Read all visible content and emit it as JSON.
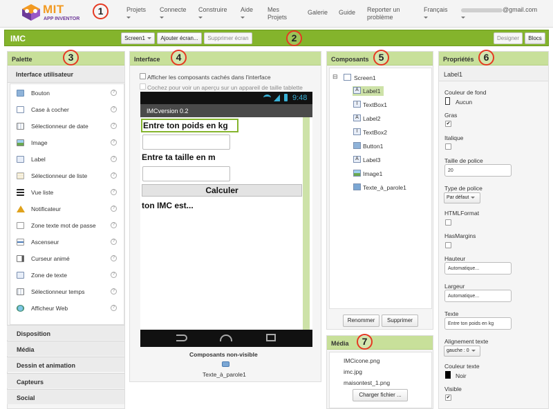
{
  "topbar": {
    "logo_title": "MIT",
    "logo_subtitle": "APP INVENTOR",
    "menu": [
      "Projets",
      "Connecte",
      "Construire",
      "Aide"
    ],
    "links": [
      "Mes Projets",
      "Galerie",
      "Guide",
      "Reporter un problème"
    ],
    "language": "Français",
    "account": "@gmail.com"
  },
  "badges": [
    "1",
    "2",
    "3",
    "4",
    "5",
    "6",
    "7"
  ],
  "toolbar": {
    "project_name": "IMC",
    "screen_select": "Screen1",
    "add_screen": "Ajouter écran...",
    "remove_screen": "Supprimer écran",
    "designer": "Designer",
    "blocks": "Blocs"
  },
  "palette": {
    "title": "Palette",
    "section": "Interface utilisateur",
    "items": [
      {
        "label": "Bouton",
        "icon": "button-icon"
      },
      {
        "label": "Case à cocher",
        "icon": "checkbox-icon"
      },
      {
        "label": "Sélectionneur de date",
        "icon": "date-picker-icon"
      },
      {
        "label": "Image",
        "icon": "image-icon"
      },
      {
        "label": "Label",
        "icon": "label-icon"
      },
      {
        "label": "Sélectionneur de liste",
        "icon": "list-picker-icon"
      },
      {
        "label": "Vue liste",
        "icon": "list-view-icon"
      },
      {
        "label": "Notificateur",
        "icon": "notifier-icon"
      },
      {
        "label": "Zone texte mot de passe",
        "icon": "password-icon"
      },
      {
        "label": "Ascenseur",
        "icon": "slider-icon"
      },
      {
        "label": "Curseur animé",
        "icon": "spinner-icon"
      },
      {
        "label": "Zone de texte",
        "icon": "textbox-icon"
      },
      {
        "label": "Sélectionneur temps",
        "icon": "time-picker-icon"
      },
      {
        "label": "Afficheur Web",
        "icon": "web-viewer-icon"
      }
    ],
    "help_glyph": "?",
    "categories": [
      "Disposition",
      "Média",
      "Dessin et animation",
      "Capteurs",
      "Social"
    ]
  },
  "viewer": {
    "title": "Interface",
    "show_hidden": "Afficher les composants cachés dans l'interface",
    "tablet_preview": "Cochez pour voir un aperçu sur un appareil de taille tablette",
    "clock": "9:48",
    "app_title": "IMCversion 0.2",
    "label1": "Entre ton poids en kg",
    "label2": "Entre ta taille en m",
    "button1": "Calculer",
    "label3": "ton IMC est...",
    "nonvisible_title": "Composants non-visible",
    "nonvisible_item": "Texte_à_parole1"
  },
  "components": {
    "title": "Composants",
    "tree_toggle": "⊟",
    "items": [
      {
        "name": "Screen1",
        "glyph": ""
      },
      {
        "name": "Label1",
        "glyph": "A"
      },
      {
        "name": "TextBox1",
        "glyph": "I"
      },
      {
        "name": "Label2",
        "glyph": "A"
      },
      {
        "name": "TextBox2",
        "glyph": "I"
      },
      {
        "name": "Button1",
        "glyph": ""
      },
      {
        "name": "Label3",
        "glyph": "A"
      },
      {
        "name": "Image1",
        "glyph": ""
      },
      {
        "name": "Texte_à_parole1",
        "glyph": ""
      }
    ],
    "rename": "Renommer",
    "delete": "Supprimer"
  },
  "media": {
    "title": "Média",
    "files": [
      "IMCicone.png",
      "imc.jpg",
      "maisontest_1.png"
    ],
    "upload": "Charger fichier ..."
  },
  "properties": {
    "title": "Propriétés",
    "component": "Label1",
    "bg_color_label": "Couleur de fond",
    "bg_color_value": "Aucun",
    "bold_label": "Gras",
    "italic_label": "Italique",
    "font_size_label": "Taille de police",
    "font_size_value": "20",
    "font_type_label": "Type de police",
    "font_type_value": "Par défaut",
    "html_label": "HTMLFormat",
    "margins_label": "HasMargins",
    "height_label": "Hauteur",
    "height_value": "Automatique...",
    "width_label": "Largeur",
    "width_value": "Automatique...",
    "text_label": "Texte",
    "text_value": "Entre ton poids en kg",
    "align_label": "Alignement texte",
    "align_value": "gauche : 0",
    "text_color_label": "Couleur texte",
    "text_color_value": "Noir",
    "visible_label": "Visible",
    "check_glyph": "✔"
  },
  "colors": {
    "accent_green": "#84b42c",
    "panel_header": "#c8e09a",
    "badge_red": "#e53922",
    "phone_frame": "#222222"
  }
}
